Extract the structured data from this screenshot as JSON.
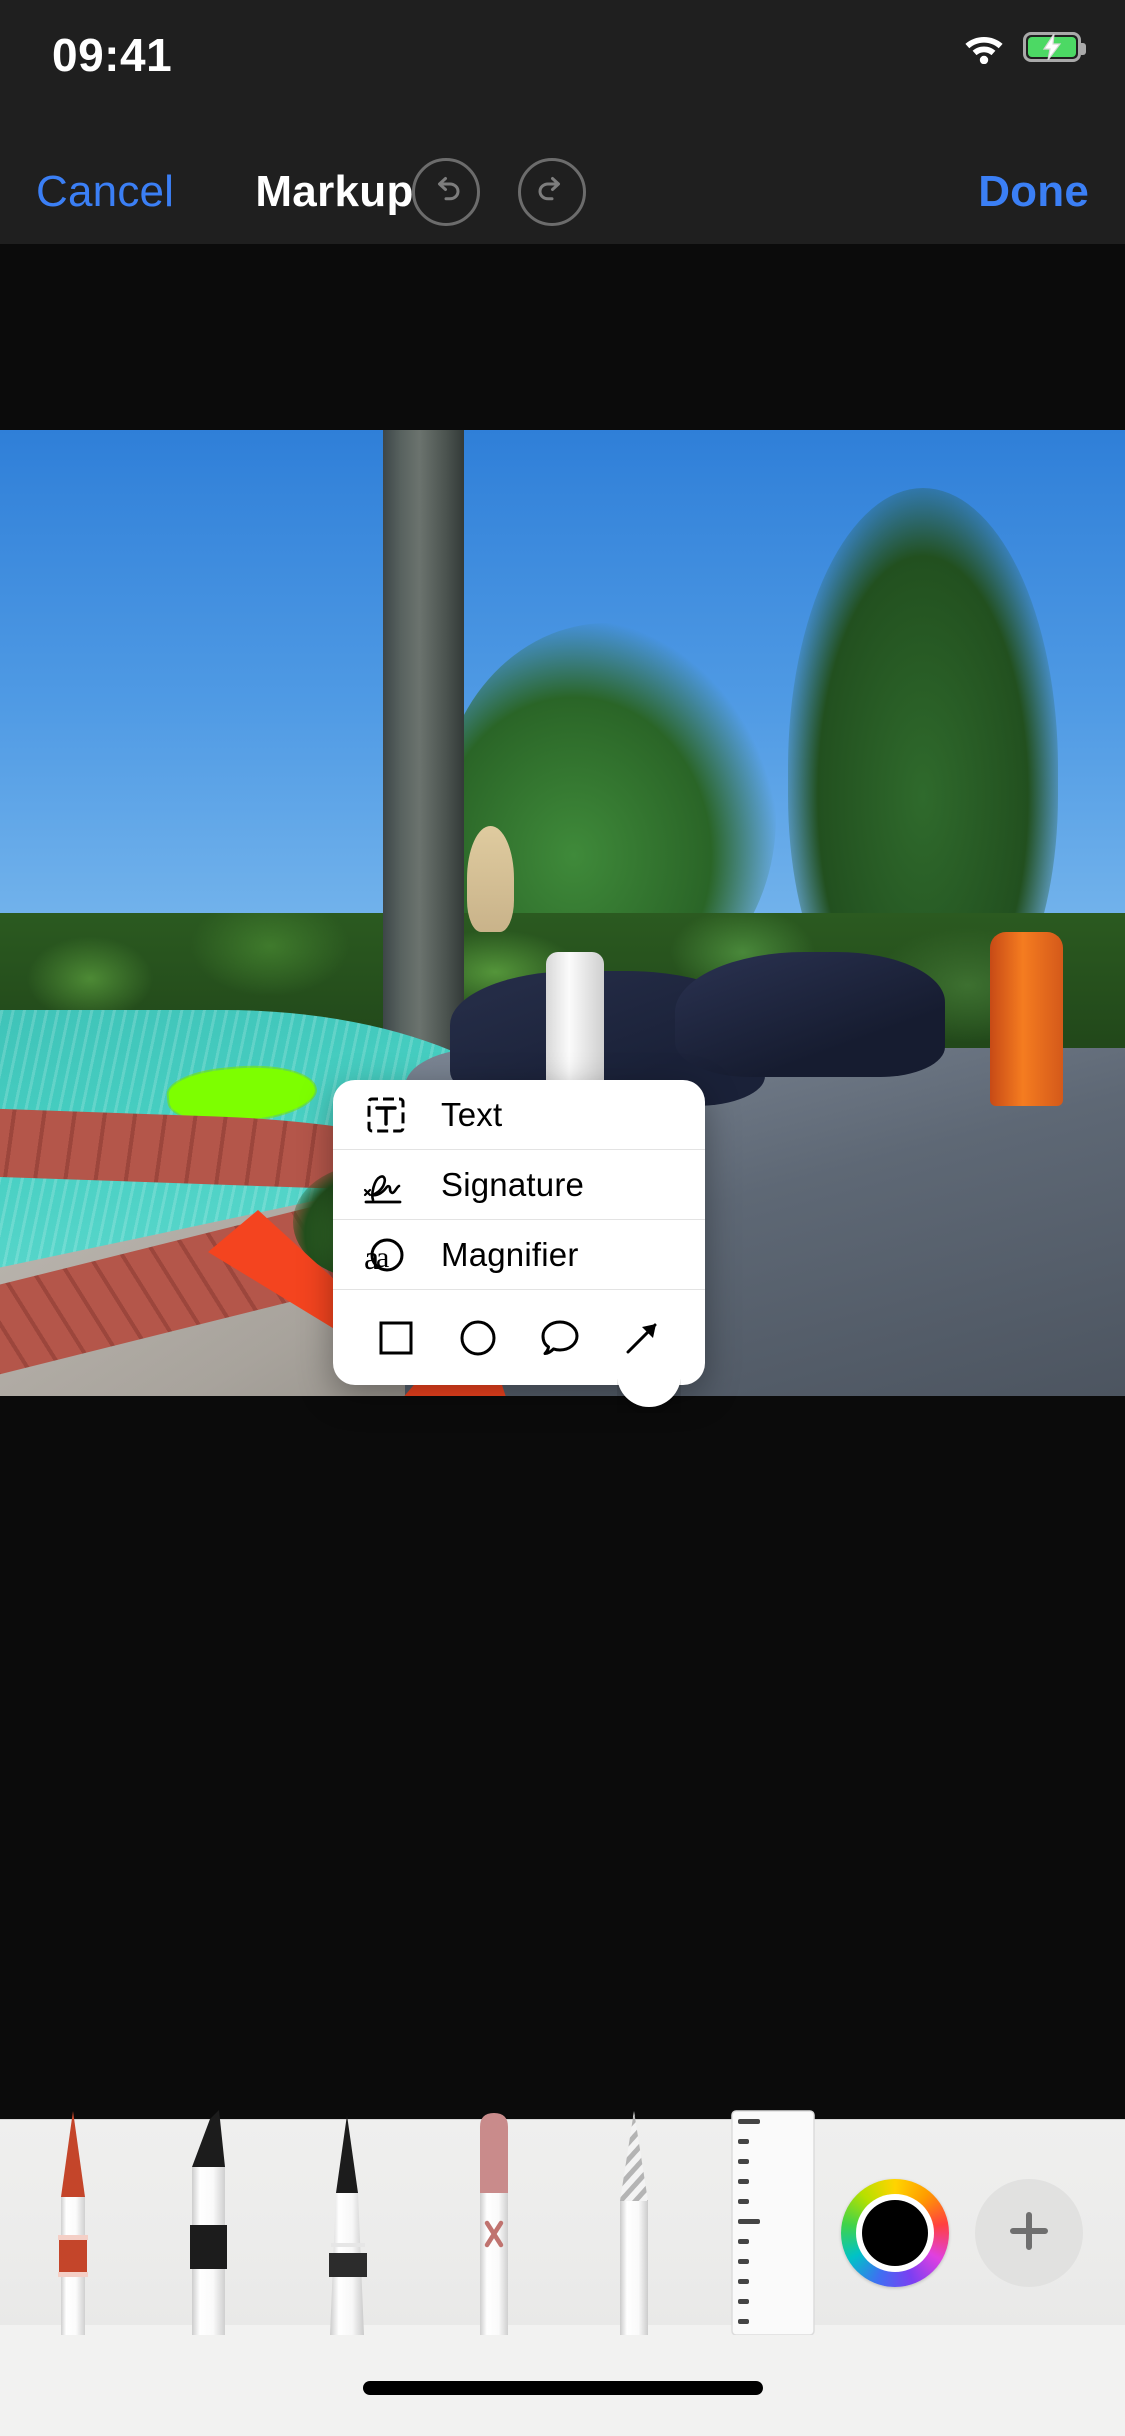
{
  "status_bar": {
    "time": "09:41",
    "wifi_icon": "wifi-icon",
    "battery_icon": "battery-charging-icon"
  },
  "nav_bar": {
    "cancel_label": "Cancel",
    "title": "Markup",
    "undo_icon": "undo-arrow-icon",
    "redo_icon": "redo-arrow-icon",
    "done_label": "Done",
    "accent_color": "#3b7ff5",
    "background_color": "#1f1f1f"
  },
  "canvas": {
    "background_color": "#0b0b0b",
    "annotation": {
      "type": "arrow",
      "color": "#f4441f",
      "direction": "down-right"
    }
  },
  "popup_menu": {
    "items": [
      {
        "label": "Text",
        "icon": "text-box-icon"
      },
      {
        "label": "Signature",
        "icon": "signature-icon"
      },
      {
        "label": "Magnifier",
        "icon": "magnifier-loupe-icon"
      }
    ],
    "shapes": [
      {
        "name": "Square",
        "icon": "square-shape-icon"
      },
      {
        "name": "Circle",
        "icon": "circle-shape-icon"
      },
      {
        "name": "Speech Bubble",
        "icon": "speech-bubble-shape-icon"
      },
      {
        "name": "Arrow",
        "icon": "arrow-shape-icon"
      }
    ],
    "background_color": "#ffffff"
  },
  "tool_palette": {
    "background_color": "#ececeb",
    "tools": [
      {
        "name": "Pen",
        "icon": "pen-tool-icon",
        "color": "#c4452a",
        "selected": true
      },
      {
        "name": "Highlighter",
        "icon": "highlighter-tool-icon",
        "color": "#1c1c1c",
        "selected": false
      },
      {
        "name": "Pencil",
        "icon": "pencil-tool-icon",
        "color": "#1c1c1c",
        "selected": false
      },
      {
        "name": "Eraser",
        "icon": "eraser-tool-icon",
        "color": "#c98b8b",
        "selected": false
      },
      {
        "name": "Lasso",
        "icon": "lasso-tool-icon",
        "color": "#b9b9b9",
        "selected": false
      },
      {
        "name": "Ruler",
        "icon": "ruler-tool-icon",
        "color": "#ffffff",
        "selected": false
      }
    ],
    "color_picker": {
      "name": "Color Wheel",
      "icon": "color-wheel-icon",
      "selected_color": "#000000"
    },
    "add_button": {
      "name": "Add Shape",
      "icon": "plus-icon"
    }
  },
  "home_indicator": {
    "name": "home-indicator",
    "color": "#000000"
  }
}
